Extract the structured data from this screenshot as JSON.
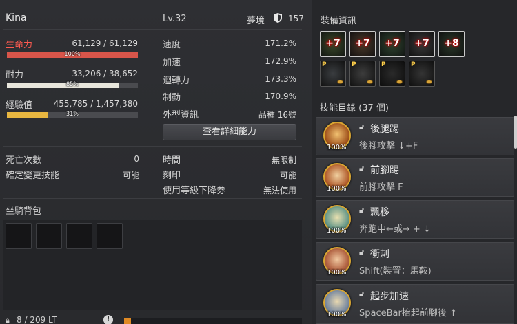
{
  "character": {
    "name": "Kina",
    "level": "Lv.32",
    "dream_label": "夢境",
    "dream_value": "157"
  },
  "stats_left": {
    "hp": {
      "label": "生命力",
      "value": "61,129 / 61,129",
      "percent_text": "100%",
      "fraction": 1.0,
      "color": "#d8554a"
    },
    "stamina": {
      "label": "耐力",
      "value": "33,206 / 38,652",
      "percent_text": "85%",
      "fraction": 0.859,
      "color": "#e8e6dc"
    },
    "exp": {
      "label": "經驗值",
      "value": "455,785 / 1,457,380",
      "percent_text": "31%",
      "fraction": 0.31,
      "color": "#e8b640"
    }
  },
  "stats_right": [
    {
      "label": "速度",
      "value": "171.2%"
    },
    {
      "label": "加速",
      "value": "172.9%"
    },
    {
      "label": "迴轉力",
      "value": "173.3%"
    },
    {
      "label": "制動",
      "value": "170.9%"
    },
    {
      "label": "外型資訊",
      "value": "品種 16號"
    }
  ],
  "detail_button": "查看詳細能力",
  "misc_left": [
    {
      "label": "死亡次數",
      "value": "0"
    },
    {
      "label": "確定變更技能",
      "value": "可能"
    }
  ],
  "misc_right": [
    {
      "label": "時間",
      "value": "無限制"
    },
    {
      "label": "刻印",
      "value": "可能"
    },
    {
      "label": "使用等級下降券",
      "value": "無法使用"
    }
  ],
  "mount_bag": {
    "title": "坐騎背包",
    "weight_text": "8 / 209 LT"
  },
  "equipment": {
    "title": "裝備資訊",
    "top_row": [
      "+7",
      "+7",
      "+7",
      "+7",
      "+8"
    ],
    "bottom_row_mark": "P"
  },
  "skills": {
    "title": "技能目錄 (37 個)",
    "items": [
      {
        "name": "後腿踢",
        "command": "後腳攻擊 ↓+F",
        "percent": "100%"
      },
      {
        "name": "前腳踢",
        "command": "前腳攻擊 F",
        "percent": "100%"
      },
      {
        "name": "飄移",
        "command": "奔跑中←或→ + ↓",
        "percent": "100%"
      },
      {
        "name": "衝刺",
        "command": "Shift(裝置：馬鞍)",
        "percent": "100%"
      },
      {
        "name": "起步加速",
        "command": "SpaceBar抬起前腳後 ↑",
        "percent": "100%"
      }
    ]
  }
}
